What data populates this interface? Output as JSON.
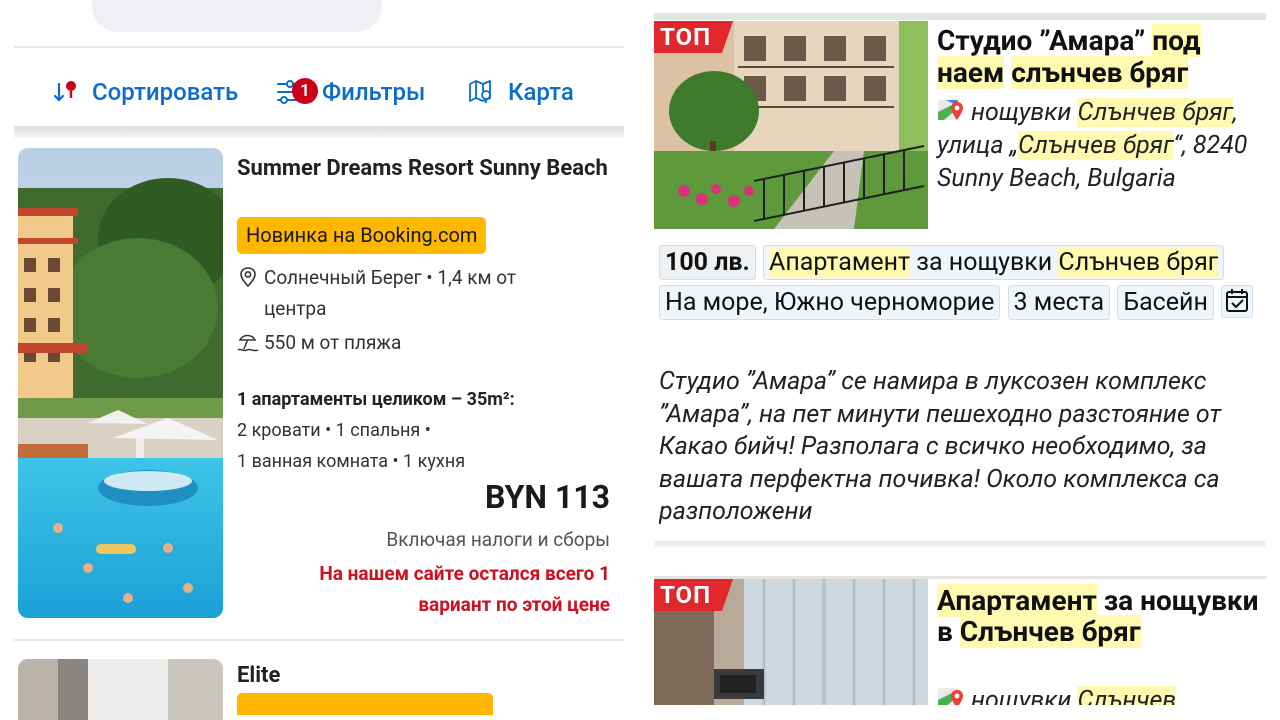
{
  "booking": {
    "toolbar": {
      "sort_label": "Сортировать",
      "filter_label": "Фильтры",
      "filter_count": "1",
      "map_label": "Карта"
    },
    "listing": {
      "title": "Summer Dreams Resort Sunny Beach",
      "badge": "Новинка на Booking.com",
      "location": "Солнечный Берег • 1,4 км от центра",
      "beach": "550 м от пляжа",
      "apartment": "1 апартаменты целиком – 35m²:",
      "details_line1": "2 кровати • 1 спальня •",
      "details_line2": "1 ванная комната • 1 кухня",
      "price": "BYN 113",
      "taxes": "Включая налоги и сборы",
      "availability": "На нашем сайте остался всего 1 вариант по этой цене"
    },
    "next_listing": {
      "title": "Elite"
    }
  },
  "classifieds": {
    "tag": "ТОП",
    "listing1": {
      "title_a": "Студио ”Амара” ",
      "title_hl1": "под",
      "title_b": " ",
      "title_hl2": "наем",
      "title_c": " ",
      "title_hl3": "слънчев бряг",
      "addr_a": "нощувки ",
      "addr_hl1": "Слънчев бряг",
      "addr_b": ", улица „",
      "addr_hl2": "Слънчев бряг",
      "addr_c": "“, 8240 Sunny Beach, Bulgaria",
      "price": "100 лв.",
      "tag_apt_hl1": "Апартамент",
      "tag_apt_mid": " за нощувки ",
      "tag_apt_hl2": "Слънчев бряг",
      "tag_sea": "На море, Южно черноморие",
      "tag_places": "3 места",
      "tag_pool": "Басейн",
      "description": "Студио ”Амара” се намира в луксозен комплекс ”Амара”, на пет минути пешеходно разстояние от Какао бийч! Разполага с всичко необходимо, за вашата перфектна почивка! Около комплекса са разположени"
    },
    "listing2": {
      "title_hl1": "Апартамент",
      "title_a": " за нощувки в ",
      "title_hl2": "Слънчев бряг",
      "addr_a": "нощувки ",
      "addr_hl1": "Слънчев"
    }
  },
  "colors": {
    "booking_blue": "#0a6ccc",
    "booking_yellow": "#ffb700",
    "alert_red": "#cc1120",
    "top_red": "#e0272c",
    "highlight": "#fffab0"
  }
}
